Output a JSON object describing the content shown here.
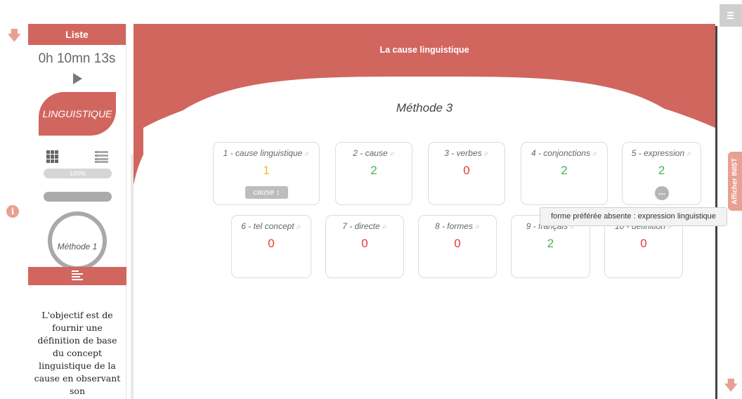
{
  "colors": {
    "accent": "#d1665e",
    "accent_light": "#e8a093",
    "value_green": "#4caf50",
    "value_red": "#e53935",
    "value_orange": "#f5b63a"
  },
  "sidebar": {
    "header": "Liste",
    "timer": "0h 10mn 13s",
    "play_icon": "play-icon",
    "category_badge": "LINGUISTIQUE",
    "progress_percent": 100,
    "progress_label": "100%",
    "methode_label": "Méthode 1",
    "description": "L'objectif est de fournir une définition de base du concept linguistique de la cause en observant son"
  },
  "main": {
    "title": "La cause linguistique",
    "method_title": "Méthode 3",
    "cards": [
      {
        "label": "1 - cause linguistique",
        "value": "1",
        "color": "#f5b63a",
        "select_value": "cause"
      },
      {
        "label": "2 - cause",
        "value": "2",
        "color": "#4caf50"
      },
      {
        "label": "3 - verbes",
        "value": "0",
        "color": "#e53935"
      },
      {
        "label": "4 - conjonctions",
        "value": "2",
        "color": "#4caf50"
      },
      {
        "label": "5 - expression",
        "value": "2",
        "color": "#4caf50",
        "more_button": "..."
      },
      {
        "label": "6 - tel concept",
        "value": "0",
        "color": "#e53935"
      },
      {
        "label": "7 - directe",
        "value": "0",
        "color": "#e53935"
      },
      {
        "label": "8 - formes",
        "value": "0",
        "color": "#e53935"
      },
      {
        "label": "9 - français",
        "value": "2",
        "color": "#4caf50"
      },
      {
        "label": "10 - définition",
        "value": "0",
        "color": "#e53935"
      }
    ],
    "tooltip": "forme préférée absente : expression linguistique"
  },
  "side_tab": {
    "label": "Afficher INIST"
  },
  "icons": {
    "top_left": "arrow-down-icon",
    "bottom_right": "arrow-down-icon",
    "info": "info-icon",
    "menu": "menu-icon",
    "view_grid": "grid-view-icon",
    "view_list": "list-view-icon",
    "search": "magnifier-icon"
  }
}
